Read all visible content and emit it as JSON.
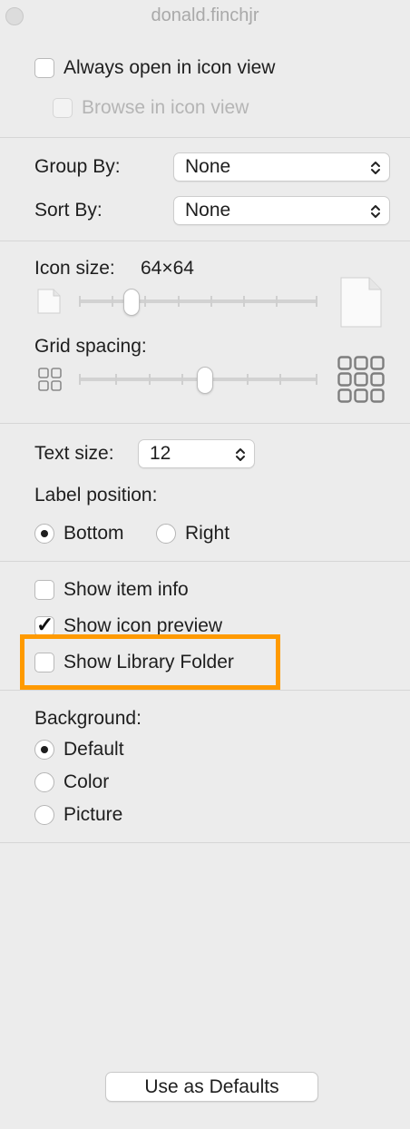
{
  "window": {
    "title": "donald.finchjr"
  },
  "view": {
    "always_open_label": "Always open in icon view",
    "always_open_checked": false,
    "browse_label": "Browse in icon view",
    "browse_checked": false
  },
  "grouping": {
    "group_by_label": "Group By:",
    "group_by_value": "None",
    "sort_by_label": "Sort By:",
    "sort_by_value": "None"
  },
  "icon": {
    "size_label": "Icon size:",
    "size_value": "64×64",
    "size_slider_fraction": 0.2,
    "grid_label": "Grid spacing:",
    "grid_slider_fraction": 0.53
  },
  "text": {
    "size_label": "Text size:",
    "size_value": "12",
    "label_position_label": "Label position:",
    "bottom_label": "Bottom",
    "right_label": "Right",
    "selected_position": "Bottom"
  },
  "options": {
    "item_info_label": "Show item info",
    "item_info_checked": false,
    "icon_preview_label": "Show icon preview",
    "icon_preview_checked": true,
    "library_label": "Show Library Folder",
    "library_checked": false
  },
  "background": {
    "label": "Background:",
    "default_label": "Default",
    "color_label": "Color",
    "picture_label": "Picture",
    "selected": "Default"
  },
  "footer": {
    "defaults_button": "Use as Defaults"
  },
  "colors": {
    "highlight": "#ff9a00",
    "window_bg": "#ececec"
  }
}
